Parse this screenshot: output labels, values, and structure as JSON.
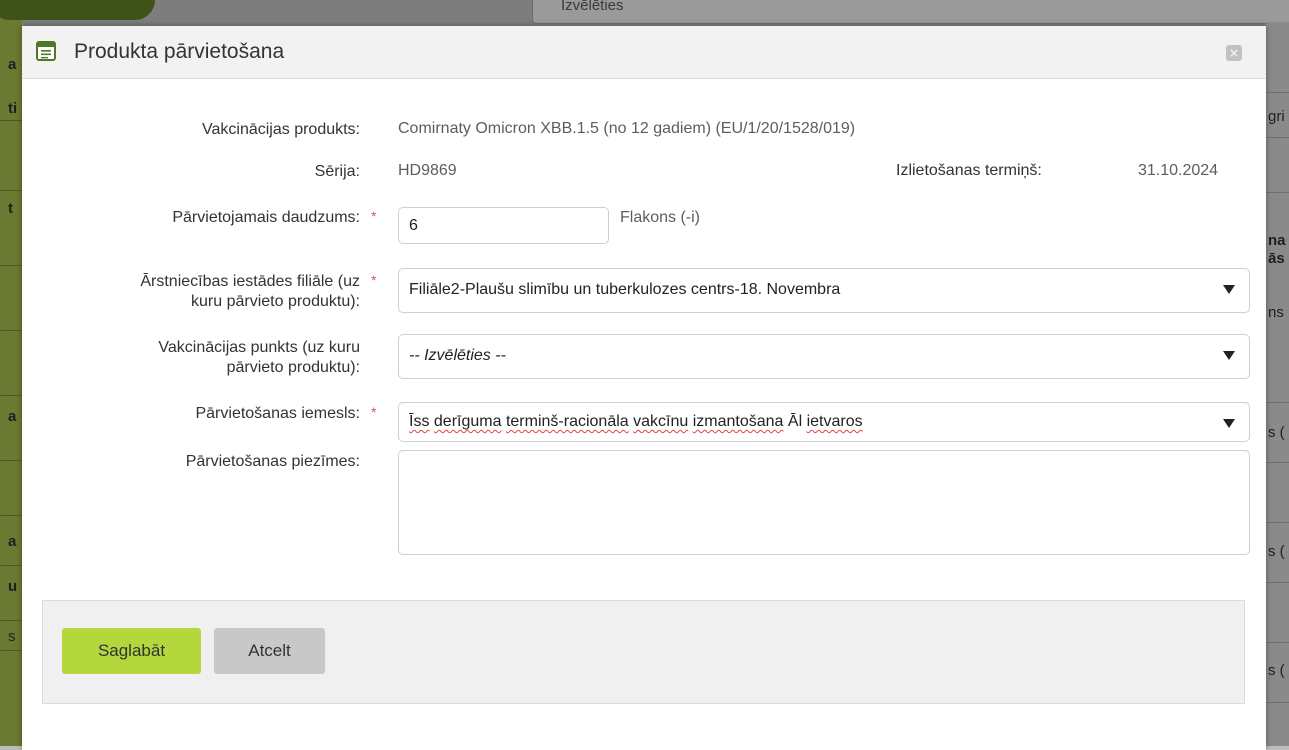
{
  "background": {
    "top_field": "Izvēlēties",
    "fragments": [
      "a",
      "ti",
      "t",
      "a",
      "a",
      "u",
      "s",
      "gri",
      "na",
      "ās",
      "ns",
      "s (",
      "s (",
      "s ("
    ]
  },
  "dialog": {
    "title": "Produkta pārvietošana",
    "close_icon": "close-icon",
    "fields": {
      "product_label": "Vakcinācijas produkts:",
      "product_value": "Comirnaty Omicron XBB.1.5 (no 12 gadiem) (EU/1/20/1528/019)",
      "series_label": "Sērija:",
      "series_value": "HD9869",
      "expiry_label": "Izlietošanas termiņš:",
      "expiry_value": "31.10.2024",
      "quantity_label": "Pārvietojamais daudzums:",
      "quantity_value": "6",
      "quantity_unit": "Flakons (-i)",
      "branch_label_1": "Ārstniecības iestādes filiāle (uz",
      "branch_label_2": "kuru pārvieto produktu):",
      "branch_value": "Filiāle2-Plaušu slimību un tuberkulozes centrs-18. Novembra",
      "point_label_1": "Vakcinācijas punkts (uz kuru",
      "point_label_2": "pārvieto produktu):",
      "point_value": "-- Izvēlēties --",
      "reason_label": "Pārvietošanas iemesls:",
      "reason_value_w1": "Īss",
      "reason_value_w2": "derīguma",
      "reason_value_w3": "terminš-racionāla",
      "reason_value_w4": "vakcīnu",
      "reason_value_w5": "izmantošana",
      "reason_value_w6": "Āl",
      "reason_value_w7": "ietvaros",
      "notes_label": "Pārvietošanas piezīmes:",
      "notes_value": "",
      "required_mark": "*"
    },
    "buttons": {
      "save": "Saglabāt",
      "cancel": "Atcelt"
    }
  },
  "colors": {
    "save_button": "#b5d73e",
    "cancel_button": "#c8c8c8",
    "required": "#d9534f",
    "overlay_left": "#6b7a33"
  }
}
